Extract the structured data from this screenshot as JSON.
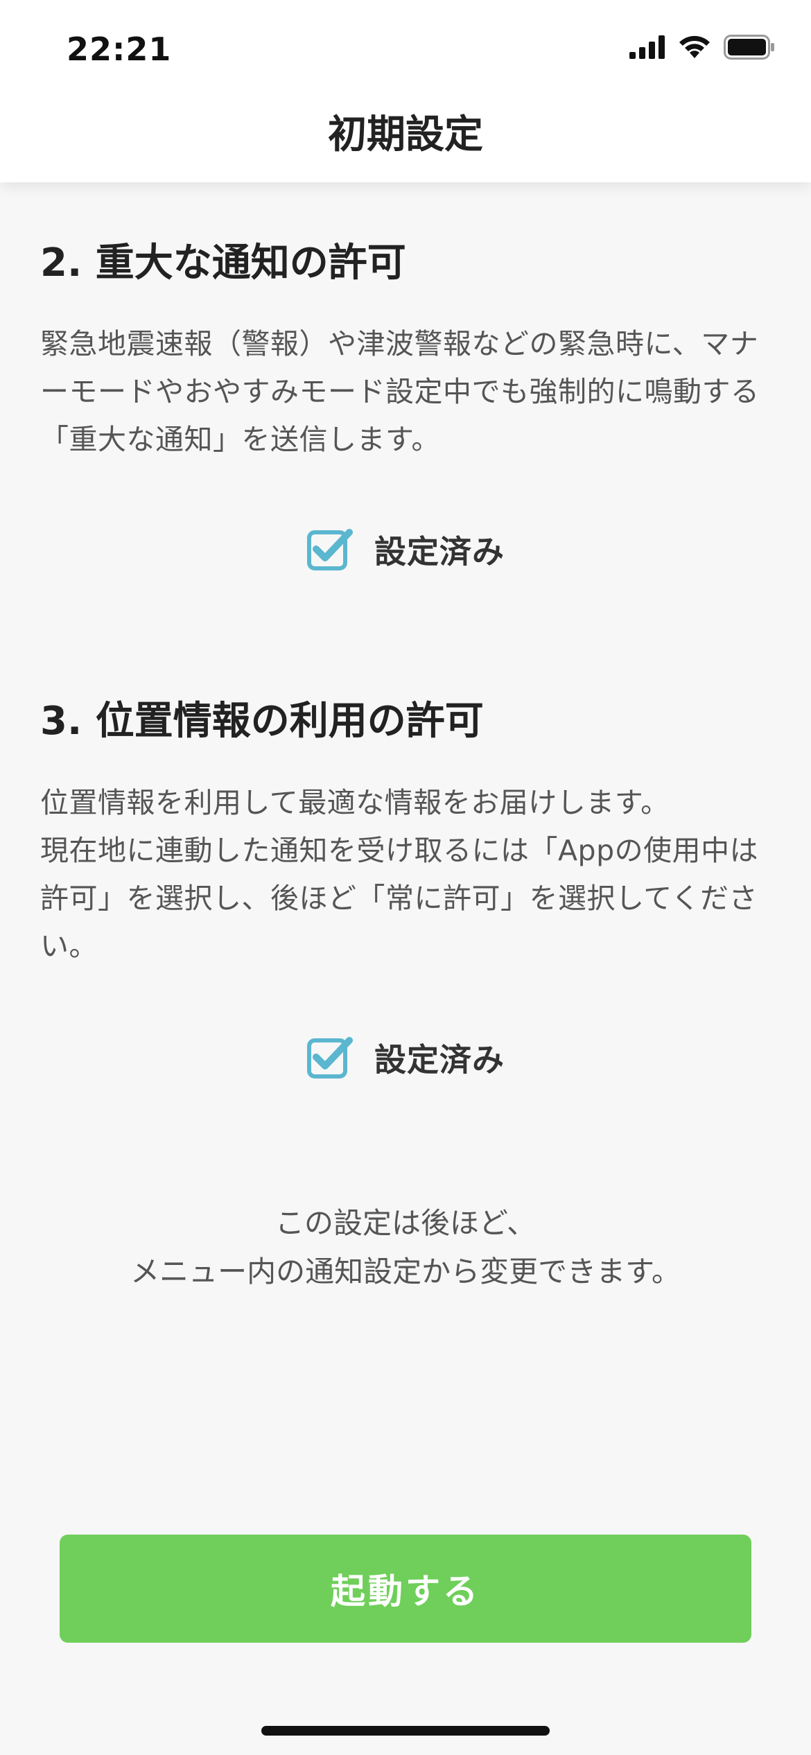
{
  "status_bar": {
    "time": "22:21",
    "icons": [
      "signal-icon",
      "wifi-icon",
      "battery-icon"
    ]
  },
  "header": {
    "title": "初期設定"
  },
  "sections": [
    {
      "title": "2. 重大な通知の許可",
      "body": "緊急地震速報（警報）や津波警報などの緊急時に、マナーモードやおやすみモード設定中でも強制的に鳴動する「重大な通知」を送信します。",
      "status_label": "設定済み",
      "status_icon": "checkbox-checked-icon"
    },
    {
      "title": "3. 位置情報の利用の許可",
      "body_lines": [
        "位置情報を利用して最適な情報をお届けします。",
        "現在地に連動した通知を受け取るには「Appの使用中は許可」を選択し、後ほど「常に許可」を選択してください。"
      ],
      "status_label": "設定済み",
      "status_icon": "checkbox-checked-icon"
    }
  ],
  "note": {
    "line1": "この設定は後ほど、",
    "line2": "メニュー内の通知設定から変更できます。"
  },
  "launch_button": {
    "label": "起動する"
  },
  "colors": {
    "accent_green": "#6fcf5a",
    "check_blue": "#5bb6cf",
    "background": "#f7f7f7"
  }
}
